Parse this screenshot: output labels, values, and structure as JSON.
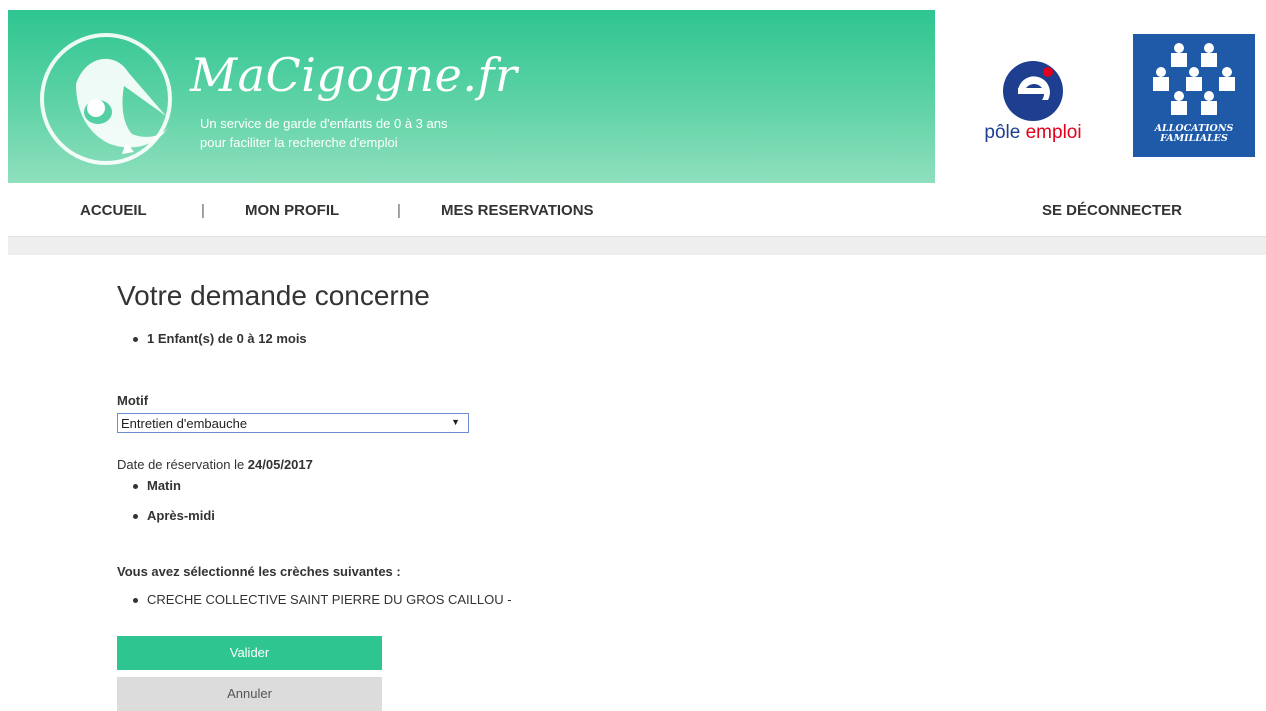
{
  "header": {
    "brand": "MaCigogne.fr",
    "tagline_line1": "Un service de garde d'enfants de 0 à 3 ans",
    "tagline_line2": "pour faciliter la recherche d'emploi",
    "partner1": {
      "text_a": "pôle ",
      "text_b": "emploi"
    },
    "partner2": {
      "line1": "ALLOCATIONS",
      "line2": "FAMILIALES"
    }
  },
  "nav": {
    "home": "ACCUEIL",
    "profile": "MON PROFIL",
    "reservations": "MES RESERVATIONS",
    "logout": "SE DÉCONNECTER",
    "separator": "|"
  },
  "main": {
    "title": "Votre demande concerne",
    "request_items": [
      "1 Enfant(s) de 0 à 12 mois"
    ],
    "motif_label": "Motif",
    "motif_value": "Entretien d'embauche",
    "date_prefix": "Date de réservation le ",
    "date_value": "24/05/2017",
    "slots": [
      "Matin",
      "Après-midi"
    ],
    "selection_label": "Vous avez sélectionné les crèches suivantes :",
    "creches": [
      "CRECHE COLLECTIVE SAINT PIERRE DU GROS CAILLOU -"
    ],
    "validate_label": "Valider",
    "cancel_label": "Annuler"
  },
  "colors": {
    "brand_green": "#2ec590",
    "pe_blue": "#1e3f8f",
    "pe_red": "#e2001a",
    "caf_blue": "#1f5aa8"
  }
}
